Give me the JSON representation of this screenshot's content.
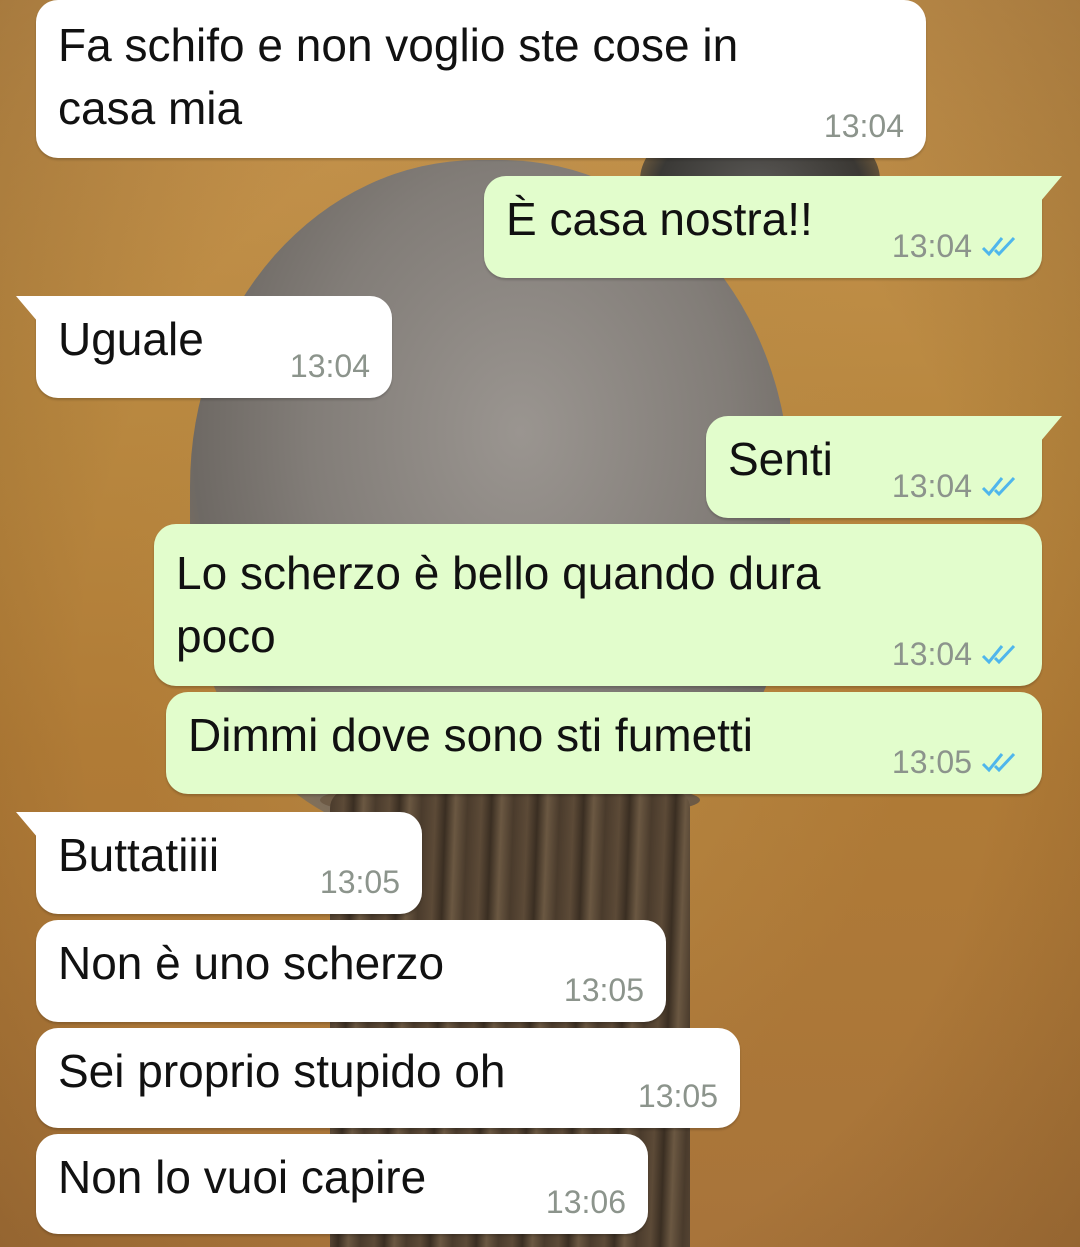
{
  "messages": [
    {
      "direction": "incoming",
      "text": "Fa schifo e non voglio ste cose in\ncasa mia",
      "time": "13:04"
    },
    {
      "direction": "outgoing",
      "text": "È casa nostra!!",
      "time": "13:04",
      "status": "read"
    },
    {
      "direction": "incoming",
      "text": "Uguale",
      "time": "13:04"
    },
    {
      "direction": "outgoing",
      "text": "Senti",
      "time": "13:04",
      "status": "read"
    },
    {
      "direction": "outgoing",
      "text": "Lo scherzo è bello quando dura\npoco",
      "time": "13:04",
      "status": "read"
    },
    {
      "direction": "outgoing",
      "text": "Dimmi dove sono sti fumetti",
      "time": "13:05",
      "status": "read"
    },
    {
      "direction": "incoming",
      "text": "Buttatiiii",
      "time": "13:05"
    },
    {
      "direction": "incoming",
      "text": "Non è uno scherzo",
      "time": "13:05"
    },
    {
      "direction": "incoming",
      "text": "Sei proprio stupido oh",
      "time": "13:05"
    },
    {
      "direction": "incoming",
      "text": "Non lo vuoi capire",
      "time": "13:06"
    }
  ],
  "colors": {
    "incoming_bubble": "#ffffff",
    "outgoing_bubble": "#e2fdcc",
    "timestamp": "#8c948c",
    "read_check": "#4fb6ec"
  },
  "icons": {
    "read_status": "double-check-icon"
  }
}
